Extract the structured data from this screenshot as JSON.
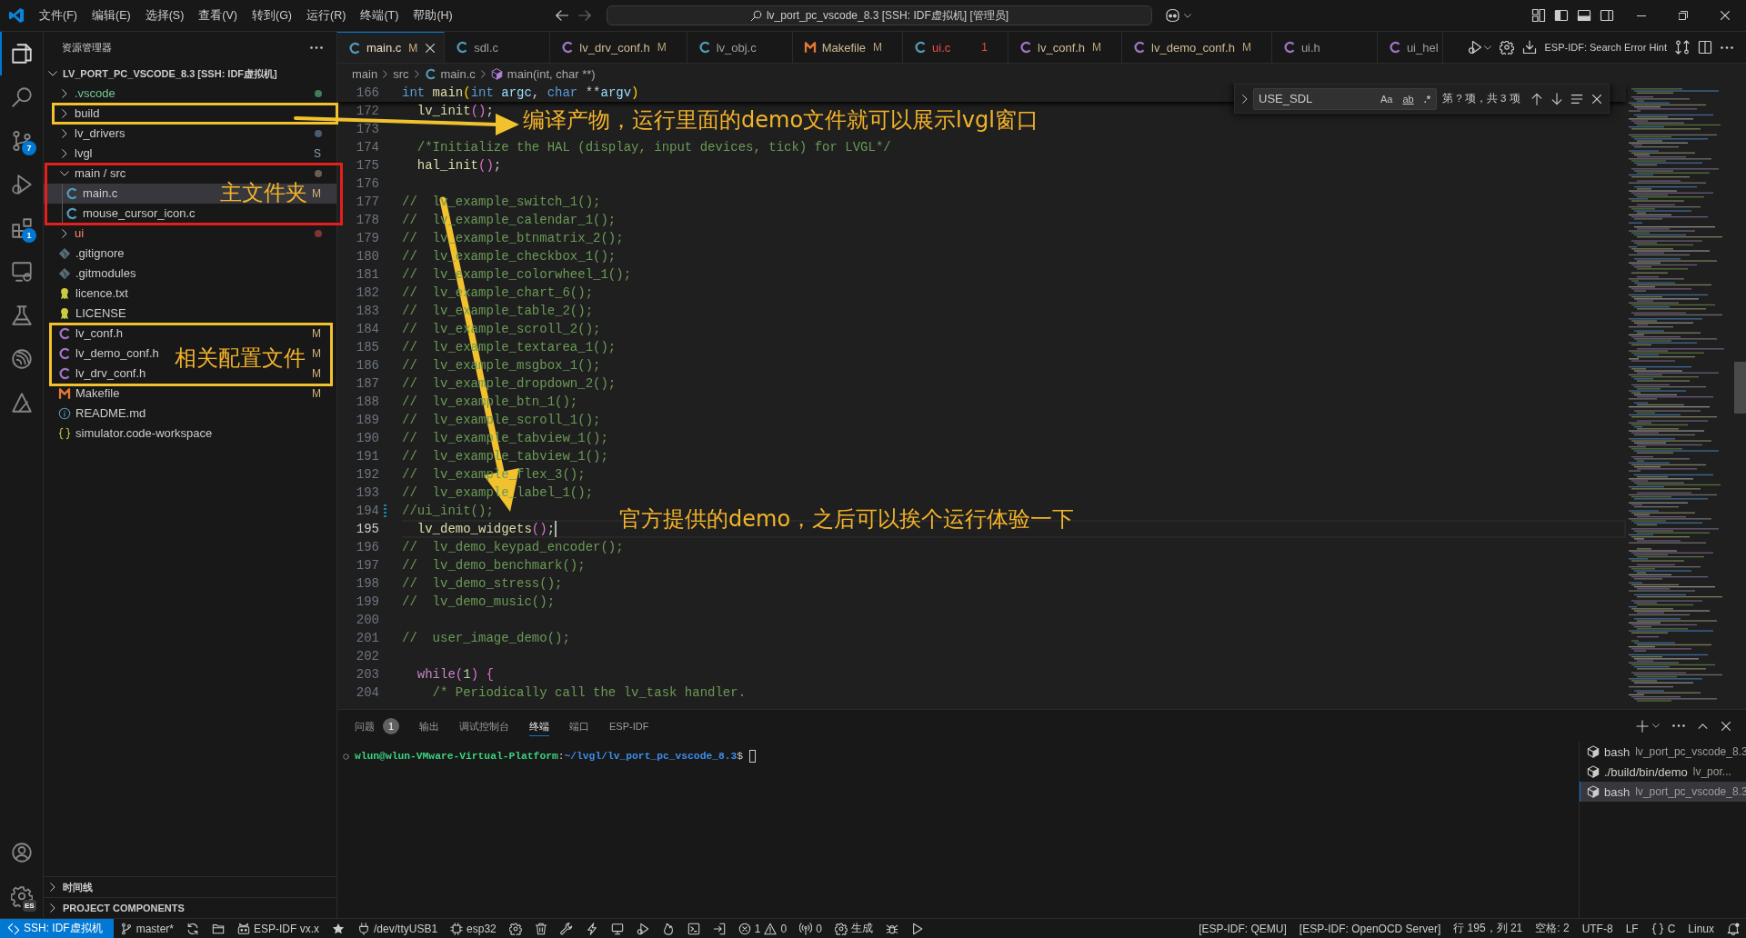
{
  "title_bar": {
    "menus": [
      "文件(F)",
      "编辑(E)",
      "选择(S)",
      "查看(V)",
      "转到(G)",
      "运行(R)",
      "终端(T)",
      "帮助(H)"
    ],
    "command_center": "lv_port_pc_vscode_8.3 [SSH: IDF虚拟机] [管理员]"
  },
  "activity_bar": {
    "items": [
      {
        "kind": "explorer",
        "selected": true
      },
      {
        "kind": "search",
        "selected": false
      },
      {
        "kind": "source-control",
        "selected": false,
        "badge": "7"
      },
      {
        "kind": "run-debug",
        "selected": false
      },
      {
        "kind": "extensions",
        "selected": false,
        "badge": "1"
      },
      {
        "kind": "remote",
        "selected": false
      },
      {
        "kind": "testing",
        "selected": false
      },
      {
        "kind": "esp-idf",
        "selected": false
      },
      {
        "kind": "triangle",
        "selected": false
      }
    ],
    "account_items": [
      {
        "kind": "account"
      },
      {
        "kind": "manage",
        "badge": "ES"
      }
    ]
  },
  "sidebar": {
    "title": "资源管理器",
    "root": {
      "label": "LV_PORT_PC_VSCODE_8.3 [SSH: IDF虚拟机]",
      "expanded": true,
      "children": [
        {
          "label": ".vscode",
          "kind": "folder",
          "expanded": false,
          "selected": false,
          "untracked": true,
          "error": false,
          "color": "#3f7f55"
        },
        {
          "label": "build",
          "kind": "folder",
          "expanded": false,
          "selected": false,
          "untracked": false,
          "error": false
        },
        {
          "label": "lv_drivers",
          "kind": "folder",
          "expanded": false,
          "selected": false,
          "untracked": false,
          "error": false,
          "color": "#4b5b72"
        },
        {
          "label": "lvgl",
          "kind": "folder",
          "expanded": false,
          "selected": false,
          "untracked": false,
          "error": false,
          "badge": {
            "text": "S",
            "kind": "submodule"
          }
        },
        {
          "label": "main / src",
          "kind": "folder",
          "expanded": true,
          "selected": false,
          "untracked": false,
          "error": false,
          "color": "#6a5f4e",
          "children": [
            {
              "label": "main.c",
              "kind": "c-source",
              "selected": true,
              "untracked": false,
              "error": false,
              "badge": {
                "text": "M",
                "kind": "modified"
              }
            },
            {
              "label": "mouse_cursor_icon.c",
              "kind": "c-source",
              "selected": false,
              "untracked": false,
              "error": false
            }
          ]
        },
        {
          "label": "ui",
          "kind": "folder",
          "expanded": false,
          "selected": false,
          "untracked": false,
          "error": true,
          "color": "#7a3833"
        },
        {
          "label": ".gitignore",
          "kind": "git-config",
          "selected": false,
          "untracked": false,
          "error": false
        },
        {
          "label": ".gitmodules",
          "kind": "git-config",
          "selected": false,
          "untracked": false,
          "error": false
        },
        {
          "label": "licence.txt",
          "kind": "license",
          "selected": false,
          "untracked": false,
          "error": false
        },
        {
          "label": "LICENSE",
          "kind": "license",
          "selected": false,
          "untracked": false,
          "error": false
        },
        {
          "label": "lv_conf.h",
          "kind": "c-header",
          "selected": false,
          "untracked": false,
          "error": false,
          "badge": {
            "text": "M",
            "kind": "modified"
          }
        },
        {
          "label": "lv_demo_conf.h",
          "kind": "c-header",
          "selected": false,
          "untracked": false,
          "error": false,
          "badge": {
            "text": "M",
            "kind": "modified"
          }
        },
        {
          "label": "lv_drv_conf.h",
          "kind": "c-header",
          "selected": false,
          "untracked": false,
          "error": false,
          "badge": {
            "text": "M",
            "kind": "modified"
          }
        },
        {
          "label": "Makefile",
          "kind": "makefile",
          "selected": false,
          "untracked": false,
          "error": false,
          "badge": {
            "text": "M",
            "kind": "modified"
          }
        },
        {
          "label": "README.md",
          "kind": "readme",
          "selected": false,
          "untracked": false,
          "error": false
        },
        {
          "label": "simulator.code-workspace",
          "kind": "workspace",
          "selected": false,
          "untracked": false,
          "error": false
        }
      ]
    },
    "sections": [
      {
        "label": "时间线",
        "expanded": false
      },
      {
        "label": "PROJECT COMPONENTS",
        "expanded": false
      }
    ]
  },
  "editor": {
    "tabs": [
      {
        "label": "main.c",
        "kind": "c-source",
        "selected": true,
        "modified": true,
        "error": false,
        "badge": "M"
      },
      {
        "label": "sdl.c",
        "kind": "c-source",
        "selected": false,
        "modified": false,
        "error": false
      },
      {
        "label": "lv_drv_conf.h",
        "kind": "c-header",
        "selected": false,
        "modified": true,
        "error": false,
        "badge": "M"
      },
      {
        "label": "lv_obj.c",
        "kind": "c-source",
        "selected": false,
        "modified": false,
        "error": false
      },
      {
        "label": "Makefile",
        "kind": "makefile",
        "selected": false,
        "modified": true,
        "error": false,
        "badge": "M"
      },
      {
        "label": "ui.c",
        "kind": "c-source",
        "selected": false,
        "modified": false,
        "error": true,
        "badge": "1"
      },
      {
        "label": "lv_conf.h",
        "kind": "c-header",
        "selected": false,
        "modified": true,
        "error": false,
        "badge": "M"
      },
      {
        "label": "lv_demo_conf.h",
        "kind": "c-header",
        "selected": false,
        "modified": true,
        "error": false,
        "badge": "M"
      },
      {
        "label": "ui.h",
        "kind": "c-header",
        "selected": false,
        "modified": false,
        "error": false
      },
      {
        "label": "ui_hel",
        "kind": "c-header",
        "selected": false,
        "modified": false,
        "error": false
      }
    ],
    "actions_label": "ESP-IDF: Search Error Hint",
    "breadcrumb": [
      {
        "label": "main",
        "kind": "folder"
      },
      {
        "label": "src",
        "kind": "folder"
      },
      {
        "label": "main.c",
        "kind": "c-source"
      },
      {
        "label": "main(int, char **)",
        "kind": "function"
      }
    ],
    "find": {
      "replace_expanded": false,
      "query": "USE_SDL",
      "options": [
        {
          "label": "Aa",
          "kind": "match-case",
          "selected": false
        },
        {
          "label": "ab",
          "kind": "whole-word",
          "selected": false
        },
        {
          "label": ".*",
          "kind": "regex",
          "selected": false
        }
      ],
      "result": "第 ? 项，共 3 项"
    },
    "sticky_line": {
      "number": "166",
      "tokens": [
        {
          "text": "int ",
          "kind": "keyword"
        },
        {
          "text": "main",
          "kind": "function"
        },
        {
          "text": "(",
          "kind": "bracket1"
        },
        {
          "text": "int ",
          "kind": "keyword"
        },
        {
          "text": "argc",
          "kind": "param"
        },
        {
          "text": ", ",
          "kind": "plain"
        },
        {
          "text": "char",
          "kind": "keyword"
        },
        {
          "text": " **",
          "kind": "plain"
        },
        {
          "text": "argv",
          "kind": "param"
        },
        {
          "text": ")",
          "kind": "bracket1"
        }
      ]
    },
    "lines": [
      {
        "number": "172",
        "current": false,
        "modified": false,
        "tokens": [
          {
            "text": "  lv_init",
            "kind": "function"
          },
          {
            "text": "()",
            "kind": "bracket2"
          },
          {
            "text": ";",
            "kind": "plain"
          }
        ]
      },
      {
        "number": "173",
        "current": false,
        "modified": false
      },
      {
        "number": "174",
        "current": false,
        "modified": false,
        "tokens": [
          {
            "text": "  /*Initialize the HAL (display, input devices, tick) for LVGL*/",
            "kind": "comment"
          }
        ]
      },
      {
        "number": "175",
        "current": false,
        "modified": false,
        "tokens": [
          {
            "text": "  hal_init",
            "kind": "function"
          },
          {
            "text": "()",
            "kind": "bracket2"
          },
          {
            "text": ";",
            "kind": "plain"
          }
        ]
      },
      {
        "number": "176",
        "current": false,
        "modified": false
      },
      {
        "number": "177",
        "current": false,
        "modified": false,
        "tokens": [
          {
            "text": "//  lv_example_switch_1();",
            "kind": "comment"
          }
        ]
      },
      {
        "number": "178",
        "current": false,
        "modified": false,
        "tokens": [
          {
            "text": "//  lv_example_calendar_1();",
            "kind": "comment"
          }
        ]
      },
      {
        "number": "179",
        "current": false,
        "modified": false,
        "tokens": [
          {
            "text": "//  lv_example_btnmatrix_2();",
            "kind": "comment"
          }
        ]
      },
      {
        "number": "180",
        "current": false,
        "modified": false,
        "tokens": [
          {
            "text": "//  lv_example_checkbox_1();",
            "kind": "comment"
          }
        ]
      },
      {
        "number": "181",
        "current": false,
        "modified": false,
        "tokens": [
          {
            "text": "//  lv_example_colorwheel_1();",
            "kind": "comment"
          }
        ]
      },
      {
        "number": "182",
        "current": false,
        "modified": false,
        "tokens": [
          {
            "text": "//  lv_example_chart_6();",
            "kind": "comment"
          }
        ]
      },
      {
        "number": "183",
        "current": false,
        "modified": false,
        "tokens": [
          {
            "text": "//  lv_example_table_2();",
            "kind": "comment"
          }
        ]
      },
      {
        "number": "184",
        "current": false,
        "modified": false,
        "tokens": [
          {
            "text": "//  lv_example_scroll_2();",
            "kind": "comment"
          }
        ]
      },
      {
        "number": "185",
        "current": false,
        "modified": false,
        "tokens": [
          {
            "text": "//  lv_example_textarea_1();",
            "kind": "comment"
          }
        ]
      },
      {
        "number": "186",
        "current": false,
        "modified": false,
        "tokens": [
          {
            "text": "//  lv_example_msgbox_1();",
            "kind": "comment"
          }
        ]
      },
      {
        "number": "187",
        "current": false,
        "modified": false,
        "tokens": [
          {
            "text": "//  lv_example_dropdown_2();",
            "kind": "comment"
          }
        ]
      },
      {
        "number": "188",
        "current": false,
        "modified": false,
        "tokens": [
          {
            "text": "//  lv_example_btn_1();",
            "kind": "comment"
          }
        ]
      },
      {
        "number": "189",
        "current": false,
        "modified": false,
        "tokens": [
          {
            "text": "//  lv_example_scroll_1();",
            "kind": "comment"
          }
        ]
      },
      {
        "number": "190",
        "current": false,
        "modified": false,
        "tokens": [
          {
            "text": "//  lv_example_tabview_1();",
            "kind": "comment"
          }
        ]
      },
      {
        "number": "191",
        "current": false,
        "modified": false,
        "tokens": [
          {
            "text": "//  lv_example_tabview_1();",
            "kind": "comment"
          }
        ]
      },
      {
        "number": "192",
        "current": false,
        "modified": false,
        "tokens": [
          {
            "text": "//  lv_example_flex_3();",
            "kind": "comment"
          }
        ]
      },
      {
        "number": "193",
        "current": false,
        "modified": false,
        "tokens": [
          {
            "text": "//  lv_example_label_1();",
            "kind": "comment"
          }
        ]
      },
      {
        "number": "194",
        "current": false,
        "modified": true,
        "tokens": [
          {
            "text": "//ui_init();",
            "kind": "comment"
          }
        ]
      },
      {
        "number": "195",
        "current": true,
        "modified": false,
        "tokens": [
          {
            "text": "  lv_demo_widgets",
            "kind": "function"
          },
          {
            "text": "()",
            "kind": "bracket2"
          },
          {
            "text": ";",
            "kind": "plain"
          }
        ]
      },
      {
        "number": "196",
        "current": false,
        "modified": false,
        "tokens": [
          {
            "text": "//  lv_demo_keypad_encoder();",
            "kind": "comment"
          }
        ]
      },
      {
        "number": "197",
        "current": false,
        "modified": false,
        "tokens": [
          {
            "text": "//  lv_demo_benchmark();",
            "kind": "comment"
          }
        ]
      },
      {
        "number": "198",
        "current": false,
        "modified": false,
        "tokens": [
          {
            "text": "//  lv_demo_stress();",
            "kind": "comment"
          }
        ]
      },
      {
        "number": "199",
        "current": false,
        "modified": false,
        "tokens": [
          {
            "text": "//  lv_demo_music();",
            "kind": "comment"
          }
        ]
      },
      {
        "number": "200",
        "current": false,
        "modified": false
      },
      {
        "number": "201",
        "current": false,
        "modified": false,
        "tokens": [
          {
            "text": "//  user_image_demo();",
            "kind": "comment"
          }
        ]
      },
      {
        "number": "202",
        "current": false,
        "modified": false
      },
      {
        "number": "203",
        "current": false,
        "modified": false,
        "tokens": [
          {
            "text": "  while",
            "kind": "control"
          },
          {
            "text": "(",
            "kind": "bracket2"
          },
          {
            "text": "1",
            "kind": "number"
          },
          {
            "text": ")",
            "kind": "bracket2"
          },
          {
            "text": " {",
            "kind": "bracket2"
          }
        ]
      },
      {
        "number": "204",
        "current": false,
        "modified": false,
        "tokens": [
          {
            "text": "    /* Periodically call the lv_task handler.",
            "kind": "comment"
          }
        ]
      }
    ]
  },
  "panel": {
    "tabs": [
      {
        "label": "问题",
        "badge": "1",
        "selected": false
      },
      {
        "label": "输出",
        "selected": false
      },
      {
        "label": "调试控制台",
        "selected": false
      },
      {
        "label": "终端",
        "selected": true
      },
      {
        "label": "端口",
        "selected": false
      },
      {
        "label": "ESP-IDF",
        "selected": false
      }
    ],
    "terminal": {
      "user_host": "wlun@wlun-VMware-Virtual-Platform",
      "separator": ":",
      "path": "~/lvgl/lv_port_pc_vscode_8.3",
      "symbol": "$"
    },
    "sessions": [
      {
        "name": "bash",
        "detail": "lv_port_pc_vscode_8.3",
        "selected": false
      },
      {
        "name": "./build/bin/demo",
        "detail": "lv_por...",
        "selected": false
      },
      {
        "name": "bash",
        "detail": "lv_port_pc_vscode_8.3",
        "selected": true
      }
    ]
  },
  "status_bar": {
    "left": [
      {
        "kind": "remote",
        "text": "SSH: IDF虚拟机"
      },
      {
        "kind": "branch",
        "text": "master*"
      },
      {
        "kind": "sync"
      },
      {
        "kind": "folder"
      },
      {
        "kind": "esp-idf-version",
        "text": "ESP-IDF vx.x"
      },
      {
        "kind": "star"
      },
      {
        "kind": "port",
        "text": "/dev/ttyUSB1"
      },
      {
        "kind": "target",
        "text": "esp32"
      },
      {
        "kind": "gear"
      },
      {
        "kind": "trash"
      },
      {
        "kind": "wrench"
      },
      {
        "kind": "flash"
      },
      {
        "kind": "monitor"
      },
      {
        "kind": "debug-run"
      },
      {
        "kind": "flame"
      },
      {
        "kind": "terminal"
      },
      {
        "kind": "sign-in"
      },
      {
        "kind": "problems",
        "errors": "1",
        "warnings": "0"
      },
      {
        "kind": "antenna",
        "text": "0"
      },
      {
        "kind": "build",
        "text": "生成"
      },
      {
        "kind": "bug"
      },
      {
        "kind": "play"
      }
    ],
    "right": [
      {
        "kind": "text",
        "text": "[ESP-IDF: QEMU]"
      },
      {
        "kind": "text",
        "text": "[ESP-IDF: OpenOCD Server]"
      },
      {
        "kind": "text",
        "text": "行 195，列 21"
      },
      {
        "kind": "text",
        "text": "空格: 2"
      },
      {
        "kind": "text",
        "text": "UTF-8"
      },
      {
        "kind": "text",
        "text": "LF"
      },
      {
        "kind": "language",
        "text": "C"
      },
      {
        "kind": "text",
        "text": "Linux"
      },
      {
        "kind": "bell"
      }
    ]
  },
  "annotations": [
    {
      "kind": "box",
      "color": "#f2c12e"
    },
    {
      "kind": "arrow",
      "color": "#f2c12e"
    },
    {
      "kind": "note",
      "text": "编译产物，运行里面的demo文件就可以展示lvgl窗口"
    },
    {
      "kind": "box",
      "color": "#e3201b"
    },
    {
      "kind": "note",
      "text": "主文件夹"
    },
    {
      "kind": "arrow",
      "color": "#f2c12e"
    },
    {
      "kind": "box",
      "color": "#f2c12e"
    },
    {
      "kind": "note",
      "text": "相关配置文件"
    },
    {
      "kind": "note",
      "text": "官方提供的demo，之后可以挨个运行体验一下"
    }
  ]
}
